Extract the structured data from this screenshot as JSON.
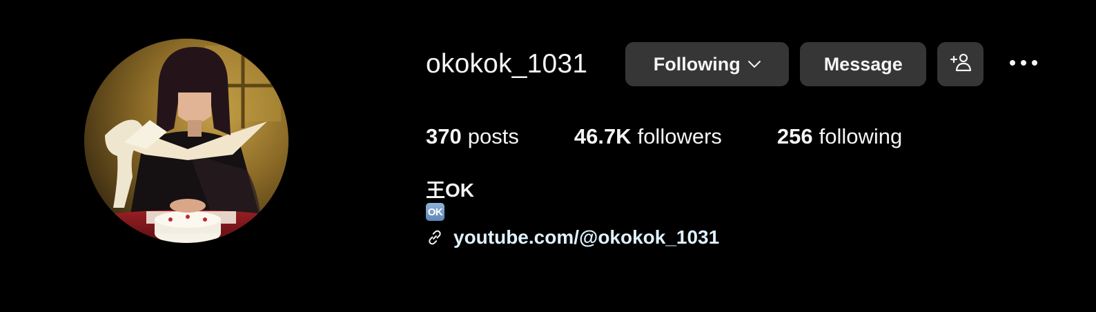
{
  "profile": {
    "username": "okokok_1031",
    "avatar_icon": "profile-photo",
    "actions": {
      "following_label": "Following",
      "following_icon": "chevron-down-icon",
      "message_label": "Message",
      "add_user_icon": "person-add-icon",
      "more_icon": "more-options-icon"
    },
    "stats": {
      "posts_count": "370",
      "posts_label": "posts",
      "followers_count": "46.7K",
      "followers_label": "followers",
      "following_count": "256",
      "following_label": "following"
    },
    "bio": {
      "display_name": "王OK",
      "emoji_badge": "OK",
      "link_icon": "link-icon",
      "link_text": "youtube.com/@okokok_1031"
    }
  },
  "colors": {
    "background": "#000000",
    "text": "#f5f5f5",
    "button_bg": "#363636",
    "link_text": "#e0f1ff",
    "ok_badge": "#6f97c4"
  }
}
